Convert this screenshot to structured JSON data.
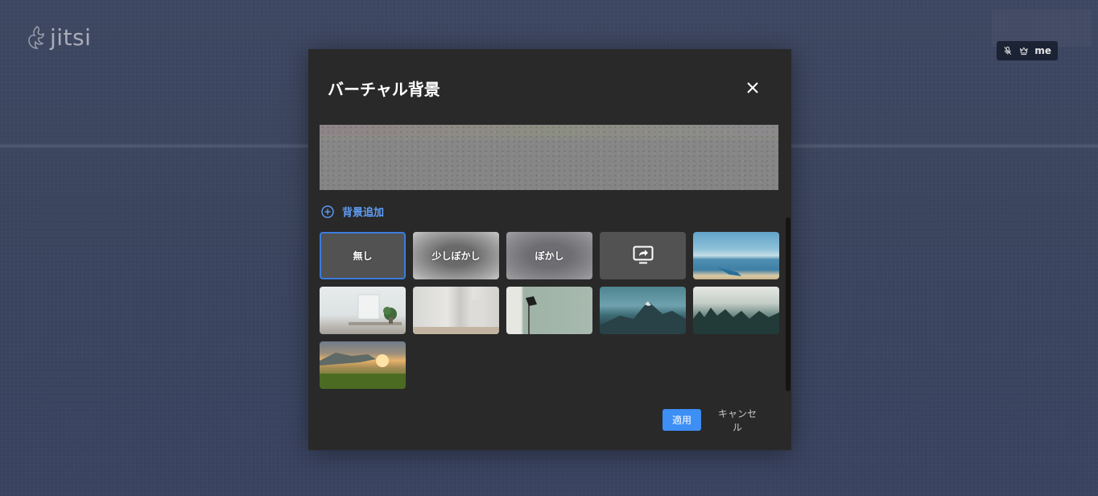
{
  "app": {
    "logo_text": "jitsi",
    "local_participant_name": "me"
  },
  "dialog": {
    "title": "バーチャル背景",
    "add_background_label": "背景追加",
    "options": {
      "none_label": "無し",
      "slight_blur_label": "少しぼかし",
      "blur_label": "ぼかし"
    },
    "apply_label": "適用",
    "cancel_label": "キャンセル"
  },
  "icons": {
    "logo": "jitsi-logo-icon",
    "muted_mic": "mic-off-icon",
    "moderator": "crown-icon",
    "close": "close-icon",
    "add": "plus-circle-icon",
    "share_desktop": "share-desktop-icon"
  },
  "colors": {
    "accent": "#3d8ef5",
    "selected_border": "#3b7bdb",
    "link": "#5e9df6",
    "dialog_bg": "#292929"
  }
}
